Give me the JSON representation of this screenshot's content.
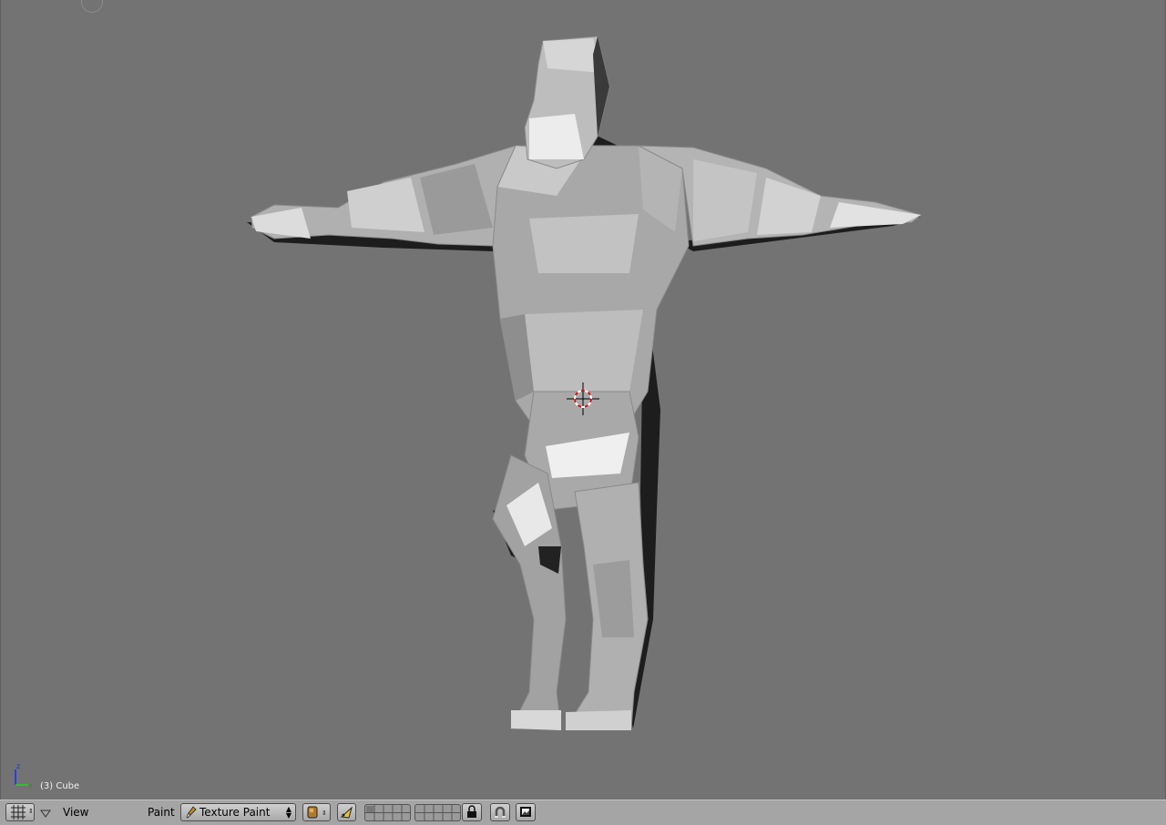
{
  "viewport": {
    "object_label": "(3) Cube",
    "axis_z": "z",
    "axis_y": "y"
  },
  "header": {
    "editor_type_icon": "grid-icon",
    "view_menu": "View",
    "mode_label": "Paint",
    "mode_value": "Texture Paint",
    "shading_icon": "solid-shading-icon",
    "pivot_icon": "pivot-icon",
    "lock_icon": "lock-icon",
    "snap_icon": "magnet-icon",
    "render_icon": "render-icon"
  },
  "colors": {
    "viewport_bg": "#737373",
    "header_bg": "#a5a5a5",
    "cursor_red": "#d01010"
  }
}
